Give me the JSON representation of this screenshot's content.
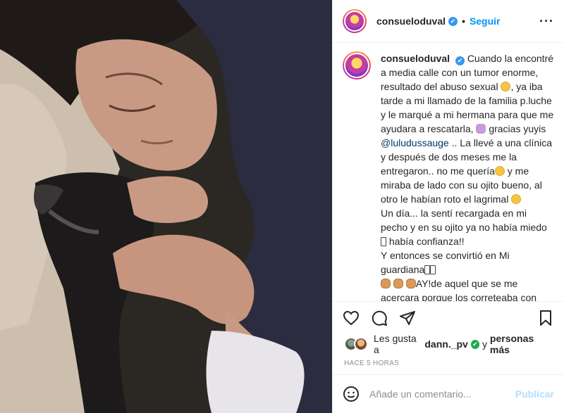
{
  "header": {
    "username": "consueloduval",
    "follow_label": "Seguir",
    "separator": "•",
    "verified_mark": "✔"
  },
  "caption": {
    "username": "consueloduval",
    "p1": "Cuando la encontré a media calle con un tumor enorme, resultado del abuso sexual",
    "p2": ", ya iba tarde a mi llamado de la familia p.luche y le marqué a mi hermana para que me ayudara a rescatarla,",
    "p3": "gracias yuyis",
    "mention": "@luludussauge",
    "p4": ".. La llevé a una clínica y después de dos meses me la entregaron.. no me quería",
    "p5": "y me miraba de lado con su ojito bueno, al otro le habían roto el lagrimal",
    "p6": "Un día... la sentí recargada en mi pecho y en su ojito ya no había miedo",
    "p7": "había confianza!!",
    "p8": "Y entonces se convirtió en Mi guardiana",
    "p9": "AY!de aquel que se me acercara porque los correteaba con"
  },
  "actions": {
    "like_icon": "heart-icon",
    "comment_icon": "comment-icon",
    "share_icon": "share-icon",
    "save_icon": "bookmark-icon"
  },
  "likes": {
    "prefix": "Les gusta a",
    "user": "dann._pv",
    "middle": "y",
    "suffix": "personas más"
  },
  "timestamp": "Hace 5 horas",
  "comment_box": {
    "placeholder": "Añade un comentario...",
    "post_label": "Publicar"
  },
  "colors": {
    "accent": "#0095f6",
    "verified": "#3897f0",
    "post_disabled": "#b2dffc"
  }
}
